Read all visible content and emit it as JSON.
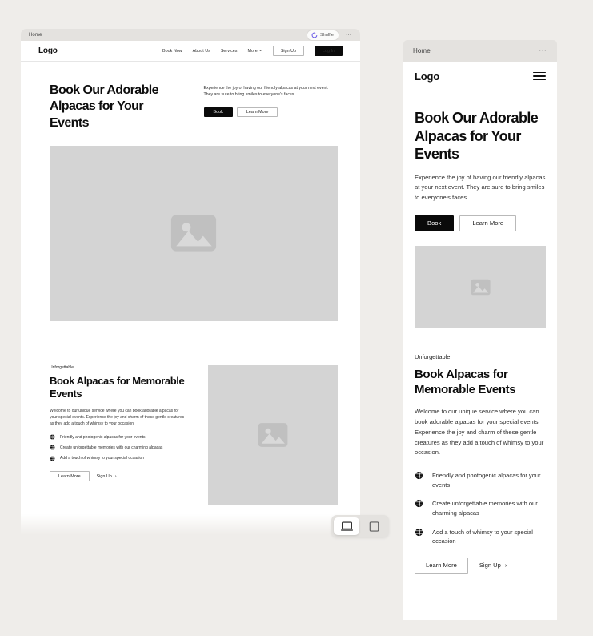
{
  "desktop": {
    "tabbar": {
      "title": "Home",
      "shuffle_label": "Shuffle",
      "shuffle_icon": "shuffle-icon",
      "more_dots": "⋯"
    },
    "header": {
      "logo": "Logo",
      "nav": [
        {
          "label": "Book Now"
        },
        {
          "label": "About Us"
        },
        {
          "label": "Services"
        },
        {
          "label": "More",
          "caret": "⌄"
        }
      ],
      "signup_label": "Sign Up",
      "login_label": "Log In"
    },
    "hero": {
      "heading": "Book Our Adorable Alpacas for Your Events",
      "paragraph": "Experience the joy of having our friendly alpacas at your next event. They are sure to bring smiles to everyone's faces.",
      "primary_label": "Book",
      "secondary_label": "Learn More",
      "image_alt": "image-placeholder"
    },
    "section2": {
      "eyebrow": "Unforgettable",
      "heading": "Book Alpacas for Memorable Events",
      "paragraph": "Welcome to our unique service where you can book adorable alpacas for your special events. Experience the joy and charm of these gentle creatures as they add a touch of whimsy to your occasion.",
      "features": [
        "Friendly and photogenic alpacas for your events",
        "Create unforgettable memories with our charming alpacas",
        "Add a touch of whimsy to your special occasion"
      ],
      "learn_more_label": "Learn More",
      "signup_link_label": "Sign Up",
      "signup_link_arrow": "›",
      "image_alt": "image-placeholder"
    }
  },
  "mobile": {
    "tabbar": {
      "title": "Home",
      "more_dots": "⋯"
    },
    "header": {
      "logo": "Logo",
      "menu_icon": "hamburger-menu-icon"
    },
    "hero": {
      "heading": "Book Our Adorable Alpacas for Your Events",
      "paragraph": "Experience the joy of having our friendly alpacas at your next event. They are sure to bring smiles to everyone's faces.",
      "primary_label": "Book",
      "secondary_label": "Learn More",
      "image_alt": "image-placeholder"
    },
    "section2": {
      "eyebrow": "Unforgettable",
      "heading": "Book Alpacas for Memorable Events",
      "paragraph": "Welcome to our unique service where you can book adorable alpacas for your special events. Experience the joy and charm of these gentle creatures as they add a touch of whimsy to your occasion.",
      "features": [
        "Friendly and photogenic alpacas for your events",
        "Create unforgettable memories with our charming alpacas",
        "Add a touch of whimsy to your special occasion"
      ],
      "learn_more_label": "Learn More",
      "signup_link_label": "Sign Up",
      "signup_link_arrow": "›"
    }
  },
  "device_toolbar": {
    "options": [
      {
        "icon": "desktop-icon",
        "selected": true
      },
      {
        "icon": "tablet-icon",
        "selected": false
      }
    ]
  },
  "colors": {
    "page_bg": "#efedea",
    "chrome_bg": "#e4e2df",
    "accent_dark": "#0a0a0a",
    "placeholder_gray": "#d4d4d4",
    "shuffle_icon": "#6c5ce7"
  }
}
